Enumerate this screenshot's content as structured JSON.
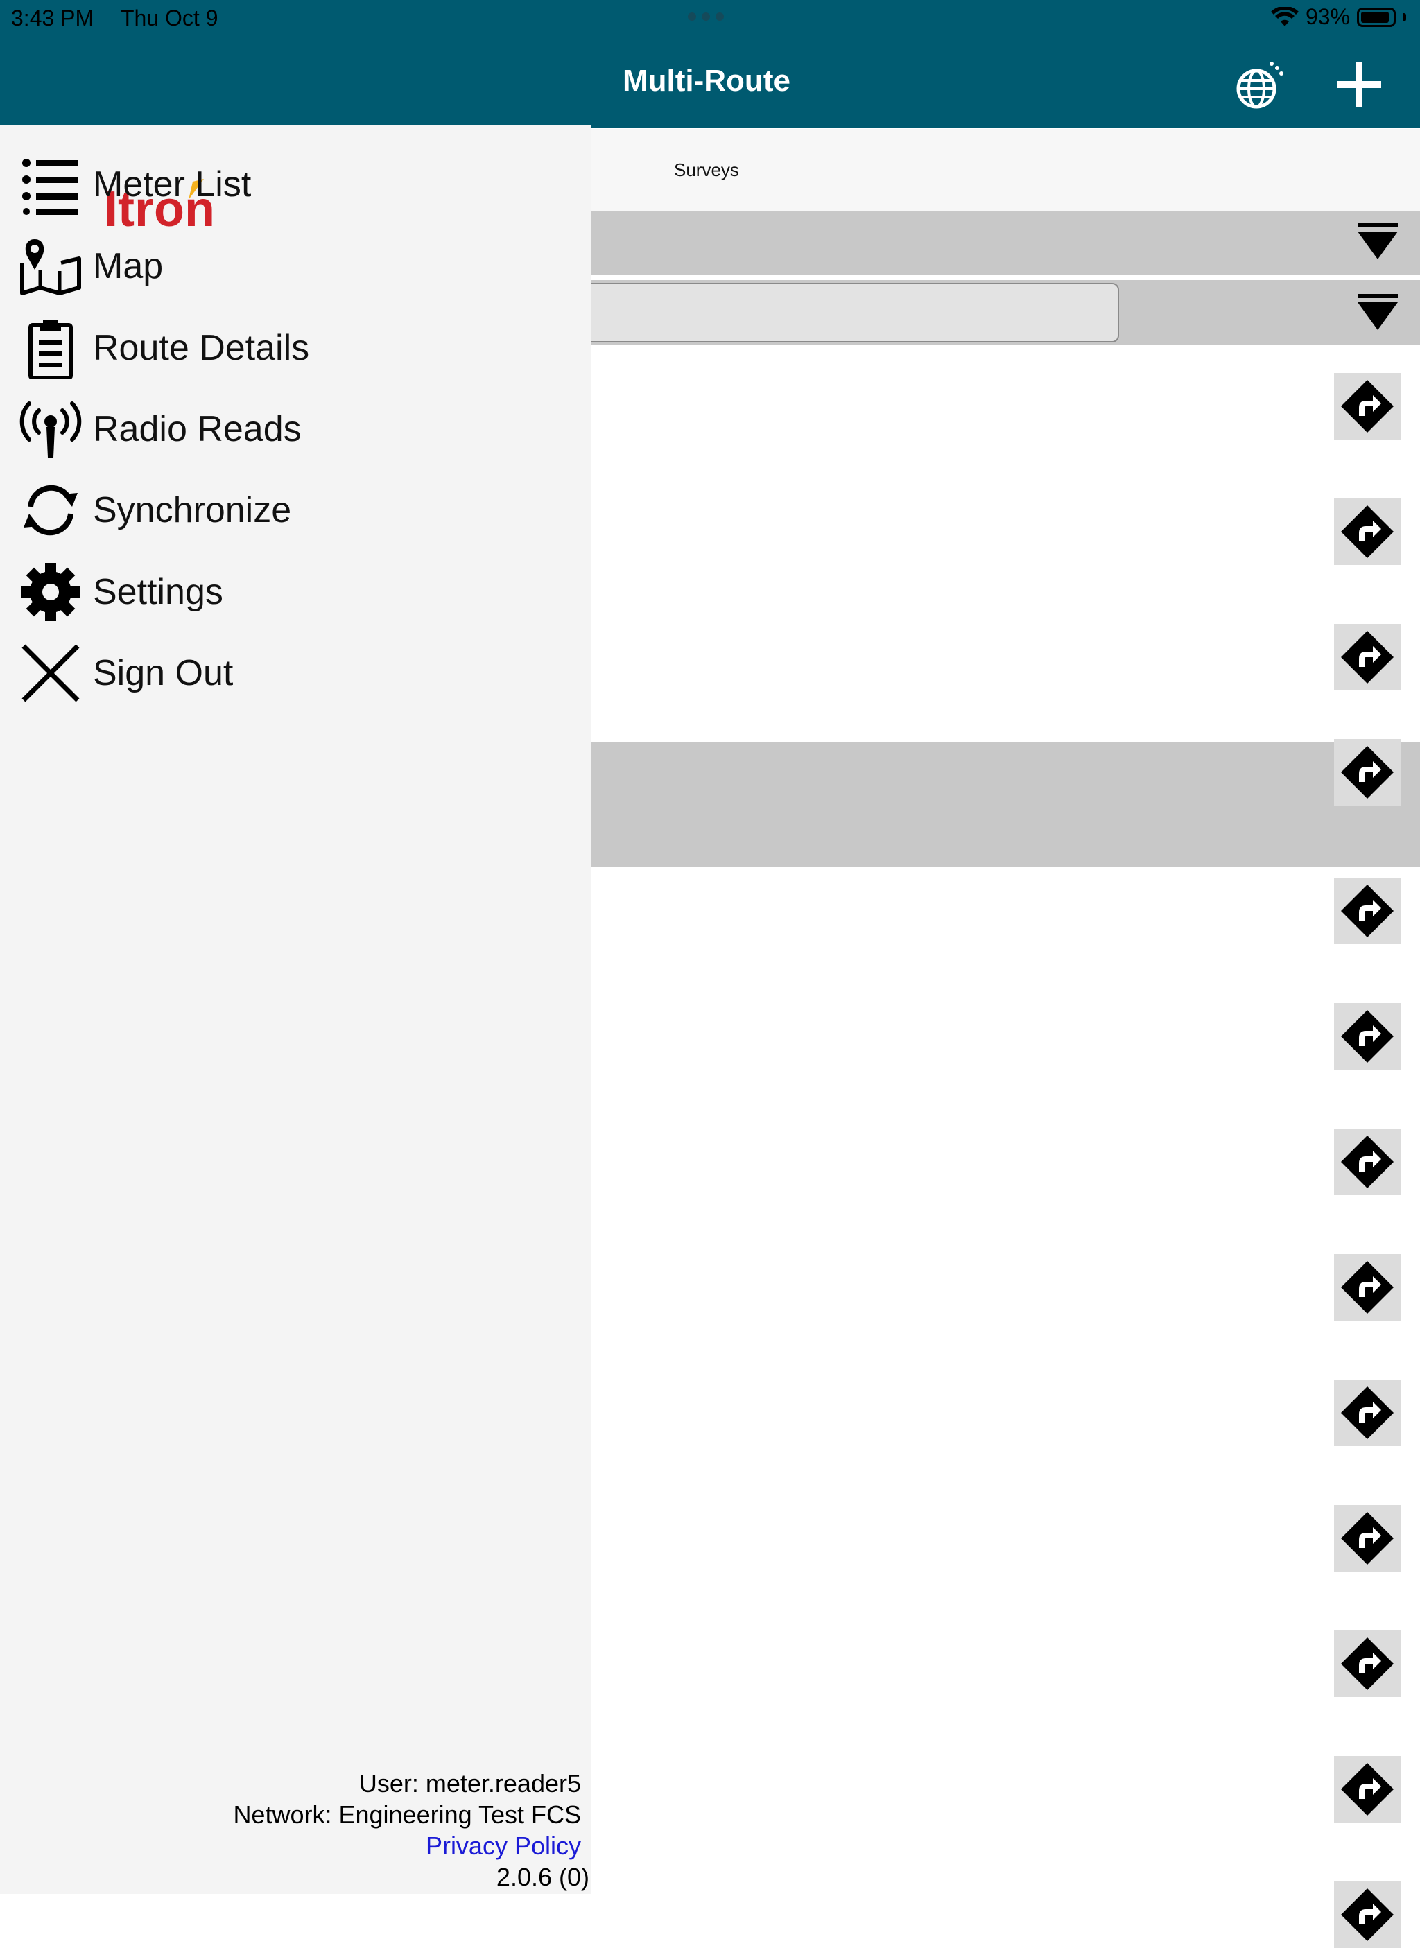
{
  "status_bar": {
    "time": "3:43 PM",
    "date": "Thu Oct 9",
    "battery": "93%"
  },
  "header": {
    "title": "Multi-Route",
    "logo_text": "Itron",
    "globe_icon": "globe-sync-icon",
    "add_icon": "plus-icon"
  },
  "tabs": {
    "surveys": "Surveys"
  },
  "drawer": {
    "items": [
      {
        "label": "Meter List",
        "icon": "list-icon"
      },
      {
        "label": "Map",
        "icon": "map-icon"
      },
      {
        "label": "Route Details",
        "icon": "clipboard-icon"
      },
      {
        "label": "Radio Reads",
        "icon": "antenna-icon"
      },
      {
        "label": "Synchronize",
        "icon": "sync-icon"
      },
      {
        "label": "Settings",
        "icon": "gear-icon"
      },
      {
        "label": "Sign Out",
        "icon": "close-icon"
      }
    ],
    "user": "User: meter.reader5",
    "network": "Network: Engineering Test FCS",
    "privacy_policy": "Privacy Policy",
    "version": "2.0.6 (0)"
  },
  "colors": {
    "header": "#005a70",
    "brand_red": "#d2232a",
    "brand_yellow": "#f5b21e",
    "link": "#1b1bd6"
  }
}
